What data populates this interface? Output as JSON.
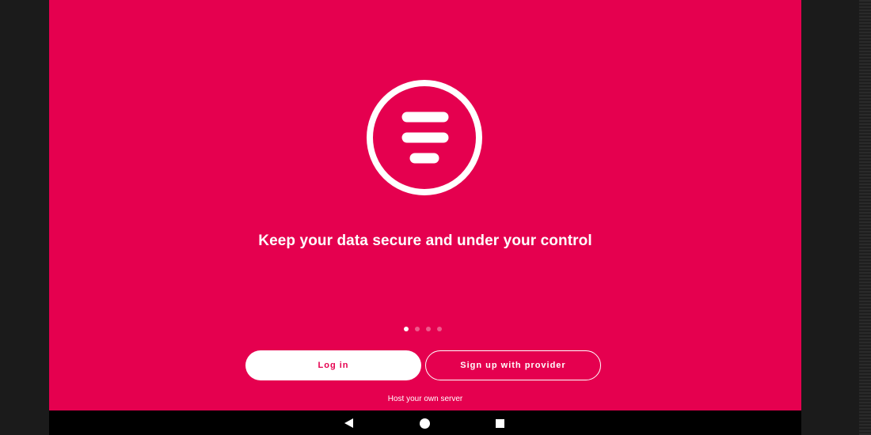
{
  "app": {
    "tagline": "Keep your data secure and under your control",
    "logo_icon": "filter-lines-circle-icon",
    "carousel": {
      "page_count": 4,
      "active_index": 0
    },
    "buttons": {
      "login_label": "Log in",
      "signup_label": "Sign up with provider"
    },
    "host_link_label": "Host your own server",
    "colors": {
      "background": "#e5004f",
      "foreground": "#ffffff"
    }
  },
  "system_nav": {
    "back_icon": "back-triangle-icon",
    "home_icon": "home-circle-icon",
    "recents_icon": "recents-square-icon"
  }
}
